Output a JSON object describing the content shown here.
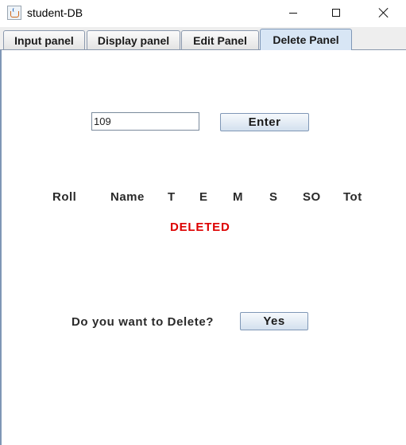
{
  "window": {
    "title": "student-DB",
    "icon": "java-cup-icon"
  },
  "tabs": [
    {
      "label": "Input panel",
      "active": false
    },
    {
      "label": "Display panel",
      "active": false
    },
    {
      "label": "Edit Panel",
      "active": false
    },
    {
      "label": "Delete Panel",
      "active": true
    }
  ],
  "delete_panel": {
    "roll_input_value": "109",
    "enter_label": "Enter",
    "columns": [
      "Roll",
      "Name",
      "T",
      "E",
      "M",
      "S",
      "SO",
      "Tot"
    ],
    "status_text": "DELETED",
    "status_color": "#dd0000",
    "prompt": "Do you want to Delete?",
    "yes_label": "Yes"
  }
}
